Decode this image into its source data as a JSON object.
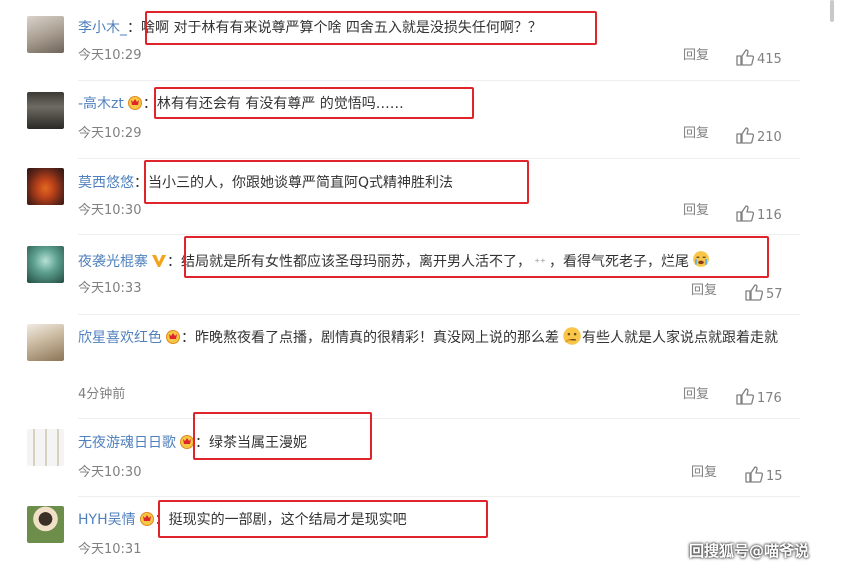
{
  "reply_label": "回复",
  "comments": [
    {
      "user": "李小木_",
      "text": "啥啊 对于林有有来说尊严算个啥 四舍五入就是没损失任何啊？？",
      "time": "今天10:29",
      "likes": "415"
    },
    {
      "user": "-高木zt",
      "text": "林有有还会有 有没有尊严 的觉悟吗……",
      "time": "今天10:29",
      "likes": "210"
    },
    {
      "user": "莫西悠悠",
      "text": "当小三的人，你跟她谈尊严简直阿Q式精神胜利法",
      "time": "今天10:30",
      "likes": "116"
    },
    {
      "user": "夜袭光棍寨",
      "text": "结局就是所有女性都应该圣母玛丽苏，离开男人活不了，",
      "text_b": "，看得气死老子，烂尾",
      "time": "今天10:33",
      "likes": "57"
    },
    {
      "user": "欣星喜欢红色",
      "text": "昨晚熬夜看了点播，剧情真的很精彩！真没网上说的那么差",
      "text_b": "有些人就是人家说点就跟着走就",
      "time": "4分钟前",
      "likes": "176"
    },
    {
      "user": "无夜游魂日日歌",
      "text": "绿茶当属王漫妮",
      "time": "今天10:30",
      "likes": "15"
    },
    {
      "user": "HYH吴情",
      "text": "挺现实的一部剧，这个结局才是现实吧",
      "time": "今天10:31",
      "likes": ""
    }
  ],
  "watermark": "回搜狐号@喵爷说",
  "colors": {
    "username": "#5081bd",
    "highlight_box": "#e0242b",
    "meta": "#808080"
  }
}
